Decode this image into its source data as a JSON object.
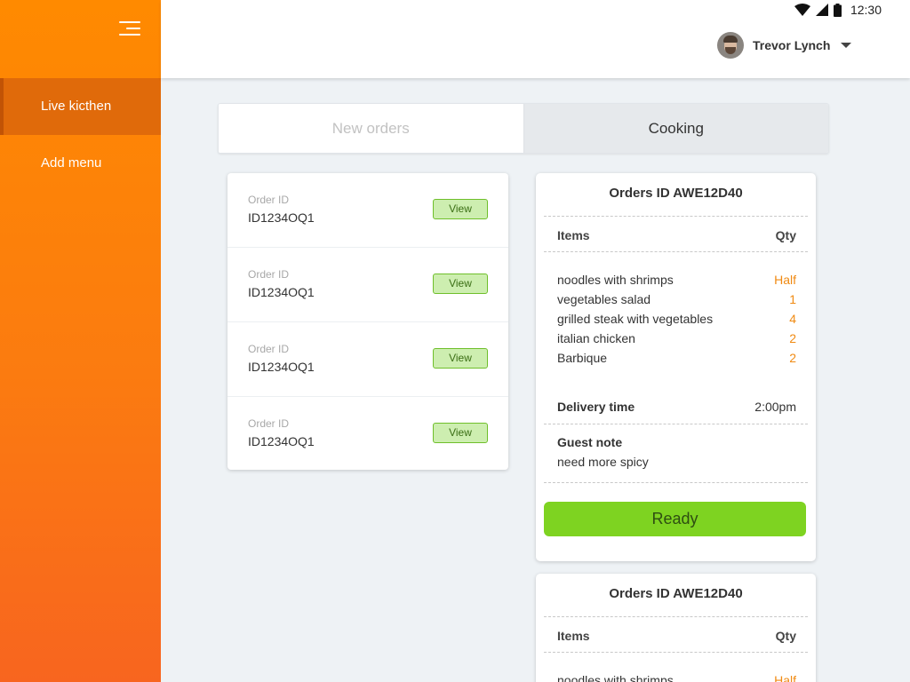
{
  "status_bar": {
    "time": "12:30",
    "icons": [
      "wifi-icon",
      "signal-icon",
      "battery-icon"
    ]
  },
  "sidebar": {
    "menu_icon": "hamburger-icon",
    "items": [
      {
        "label": "Live kicthen",
        "active": true
      },
      {
        "label": "Add menu",
        "active": false
      }
    ]
  },
  "header": {
    "user_name": "Trevor Lynch",
    "avatar": "user-avatar",
    "dropdown_icon": "caret-down-icon"
  },
  "tabs": [
    {
      "label": "New orders",
      "active": false
    },
    {
      "label": "Cooking",
      "active": true
    }
  ],
  "orders": [
    {
      "label": "Order ID",
      "id": "ID1234OQ1",
      "action": "View"
    },
    {
      "label": "Order ID",
      "id": "ID1234OQ1",
      "action": "View"
    },
    {
      "label": "Order ID",
      "id": "ID1234OQ1",
      "action": "View"
    },
    {
      "label": "Order ID",
      "id": "ID1234OQ1",
      "action": "View"
    }
  ],
  "detail_cards": [
    {
      "title": "Orders ID AWE12D40",
      "items_header": "Items",
      "qty_header": "Qty",
      "items": [
        {
          "name": "noodles with shrimps",
          "qty": "Half"
        },
        {
          "name": "vegetables salad",
          "qty": "1"
        },
        {
          "name": "grilled steak with vegetables",
          "qty": "4"
        },
        {
          "name": "italian chicken",
          "qty": "2"
        },
        {
          "name": "Barbique",
          "qty": "2"
        }
      ],
      "delivery_label": "Delivery time",
      "delivery_time": "2:00pm",
      "note_label": "Guest note",
      "note": "need more spicy",
      "ready_label": "Ready"
    },
    {
      "title": "Orders ID AWE12D40",
      "items_header": "Items",
      "qty_header": "Qty",
      "items": [
        {
          "name": "noodles with shrimps",
          "qty": "Half"
        }
      ]
    }
  ],
  "colors": {
    "accent": "#ff8a00",
    "ready": "#7ed321",
    "qty": "#f08a12"
  }
}
